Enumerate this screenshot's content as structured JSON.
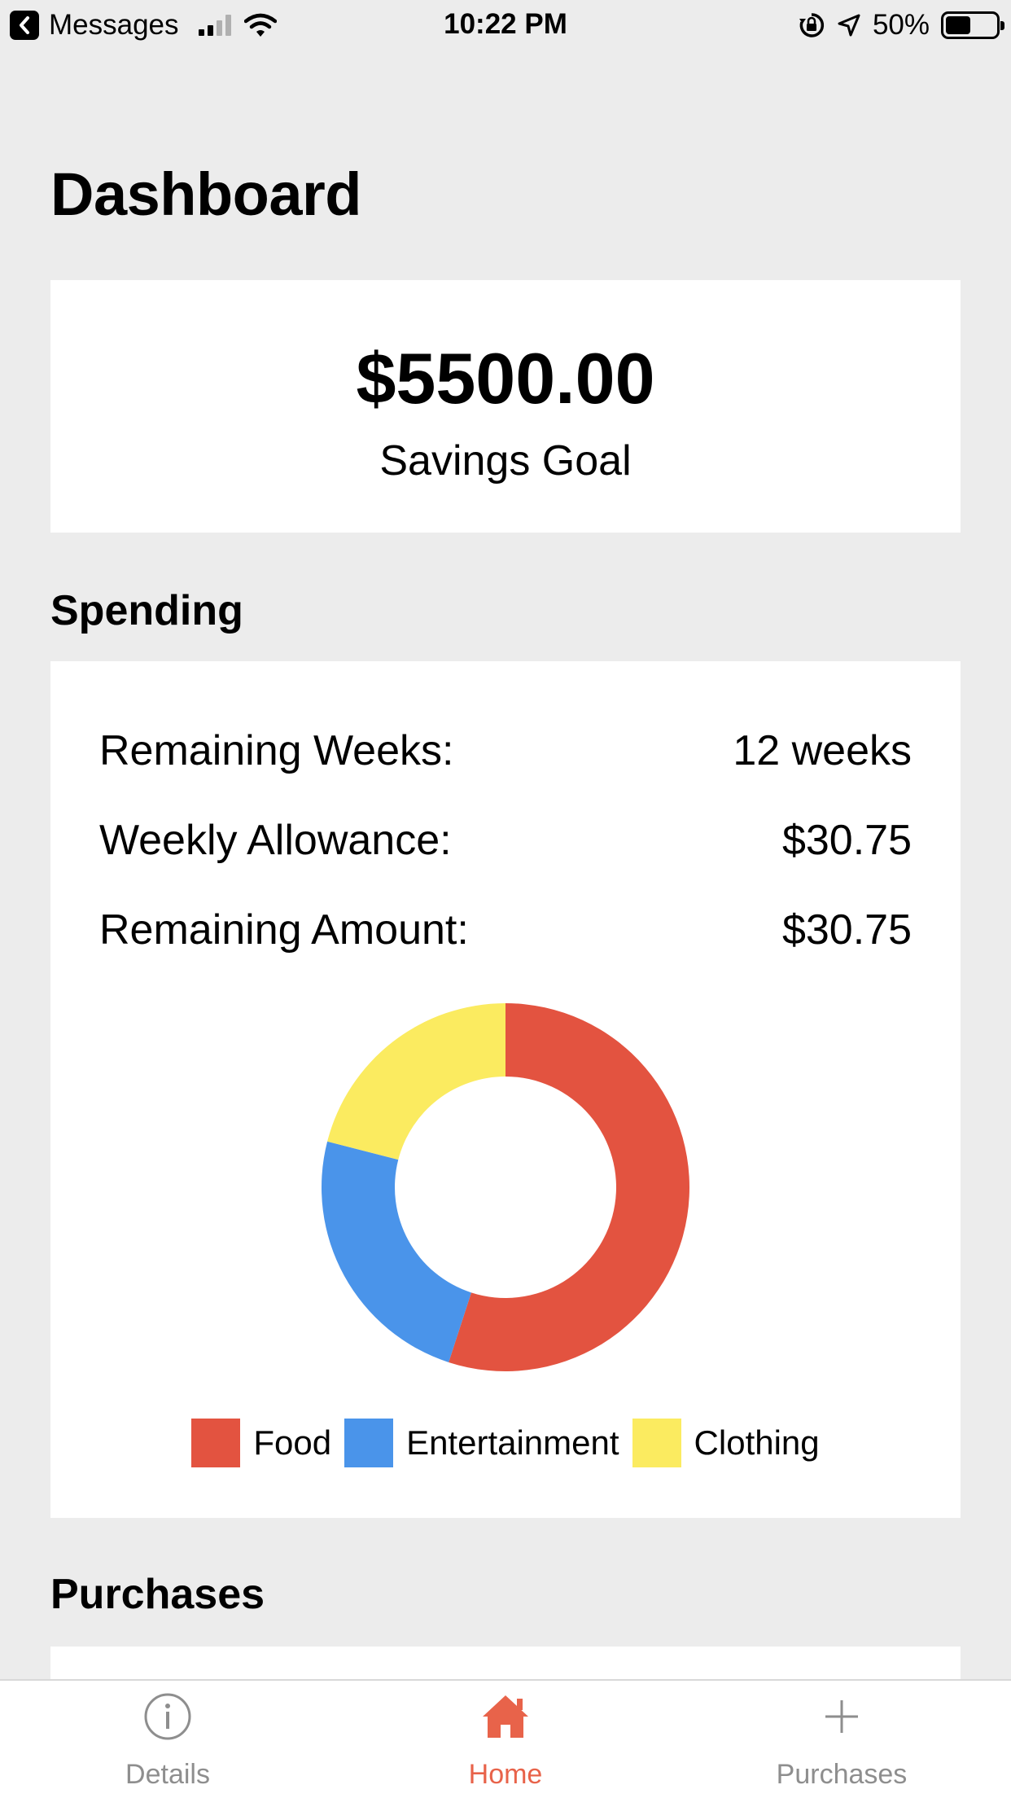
{
  "status_bar": {
    "back_app": "Messages",
    "time": "10:22 PM",
    "battery": "50%",
    "battery_level": 0.5
  },
  "page": {
    "title": "Dashboard"
  },
  "goal": {
    "amount": "$5500.00",
    "label": "Savings Goal"
  },
  "spending": {
    "title": "Spending",
    "rows": [
      {
        "label": "Remaining Weeks:",
        "value": "12 weeks"
      },
      {
        "label": "Weekly Allowance:",
        "value": "$30.75"
      },
      {
        "label": "Remaining Amount:",
        "value": "$30.75"
      }
    ]
  },
  "chart_data": {
    "type": "pie",
    "donut": true,
    "categories": [
      "Food",
      "Entertainment",
      "Clothing"
    ],
    "values": [
      55,
      24,
      21
    ],
    "colors": [
      "#e35340",
      "#4a94ea",
      "#fbeb60"
    ],
    "legend": "bottom"
  },
  "purchases": {
    "title": "Purchases"
  },
  "tab_bar": {
    "tabs": [
      {
        "label": "Details",
        "icon": "info-icon",
        "active": false
      },
      {
        "label": "Home",
        "icon": "home-icon",
        "active": true
      },
      {
        "label": "Purchases",
        "icon": "plus-icon",
        "active": false
      }
    ],
    "accent": "#e8634a"
  }
}
